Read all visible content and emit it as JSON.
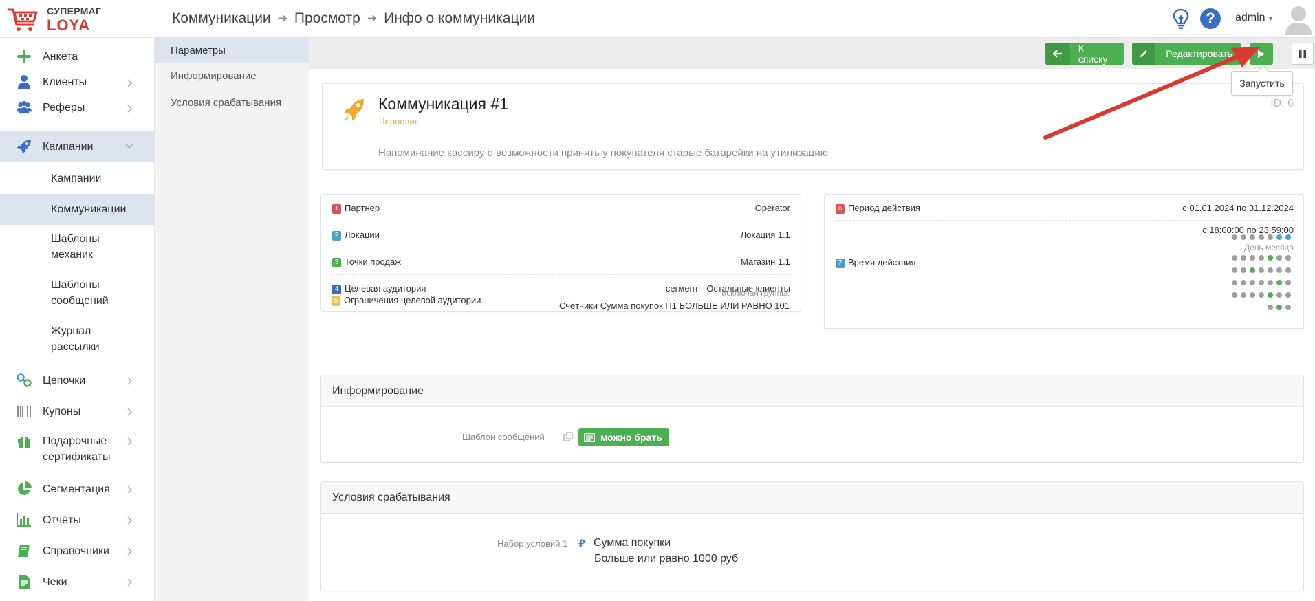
{
  "logo": {
    "line1": "СУПЕРМАГ",
    "line2": "LOYA"
  },
  "header": {
    "breadcrumb": [
      "Коммуникации",
      "Просмотр",
      "Инфо о коммуникации"
    ],
    "user": "admin"
  },
  "sidebar": {
    "items": [
      {
        "label": "Анкета"
      },
      {
        "label": "Клиенты"
      },
      {
        "label": "Реферы"
      },
      {
        "label": "Кампании"
      },
      {
        "label": "Кампании"
      },
      {
        "label": "Коммуникации"
      },
      {
        "label": "Шаблоны\nмеханик"
      },
      {
        "label": "Шаблоны\nсообщений"
      },
      {
        "label": "Журнал\nрассылки"
      },
      {
        "label": "Цепочки"
      },
      {
        "label": "Купоны"
      },
      {
        "label": "Подарочные\nсертификаты"
      },
      {
        "label": "Сегментация"
      },
      {
        "label": "Отчёты"
      },
      {
        "label": "Справочники"
      },
      {
        "label": "Чеки"
      }
    ]
  },
  "subnav": {
    "items": [
      "Параметры",
      "Информирование",
      "Условия срабатывания"
    ]
  },
  "toolbar": {
    "back_label": "К списку",
    "edit_label": "Редактировать",
    "tooltip": "Запустить"
  },
  "communication": {
    "title": "Коммуникация #1",
    "status": "Черновик",
    "id": "ID: 6",
    "description": "Напоминание кассиру о возможности принять у покупателя старые батарейки на утилизацию"
  },
  "params": [
    {
      "num": "1",
      "color": "#d9534f",
      "label": "Партнер",
      "value": "Operator"
    },
    {
      "num": "2",
      "color": "#4aa3c0",
      "label": "Локации",
      "value": "Локация 1.1"
    },
    {
      "num": "3",
      "color": "#4caf50",
      "label": "Точки продаж",
      "value": "Магазин 1.1"
    },
    {
      "num": "4",
      "color": "#3a6ec6",
      "label": "Целевая аудитория",
      "value": "сегмент - Остальные клиенты"
    },
    {
      "num": "5",
      "color": "#f0c24a",
      "label": "Ограничения целевой аудитории",
      "value_small": "исключая группы:",
      "value": "Счётчики Сумма покупок П1 БОЛЬШЕ ИЛИ РАВНО 101"
    }
  ],
  "period": {
    "row6": {
      "num": "6",
      "color": "#d9534f",
      "label": "Период действия",
      "value": "с 01.01.2024 по 31.12.2024"
    },
    "row7": {
      "num": "7",
      "color": "#4aa3c0",
      "label": "Время действия",
      "time": "с 18:00:00 по 23:59:00",
      "month_label": "День месяца"
    }
  },
  "informing": {
    "title": "Информирование",
    "template_label": "Шаблон сообщений",
    "template_name": "можно брать"
  },
  "conditions": {
    "title": "Условия срабатывания",
    "set_label": "Набор условий 1",
    "name": "Сумма покупки",
    "value": "Больше или равно 1000 руб"
  },
  "colors": {
    "accent_green": "#4caf50",
    "brand_red": "#d43d2f",
    "status_orange": "#f0a92d",
    "dot_gray": "#9e9e9e",
    "dot_green": "#4caf50",
    "dot_blue": "#4aa3c0"
  }
}
